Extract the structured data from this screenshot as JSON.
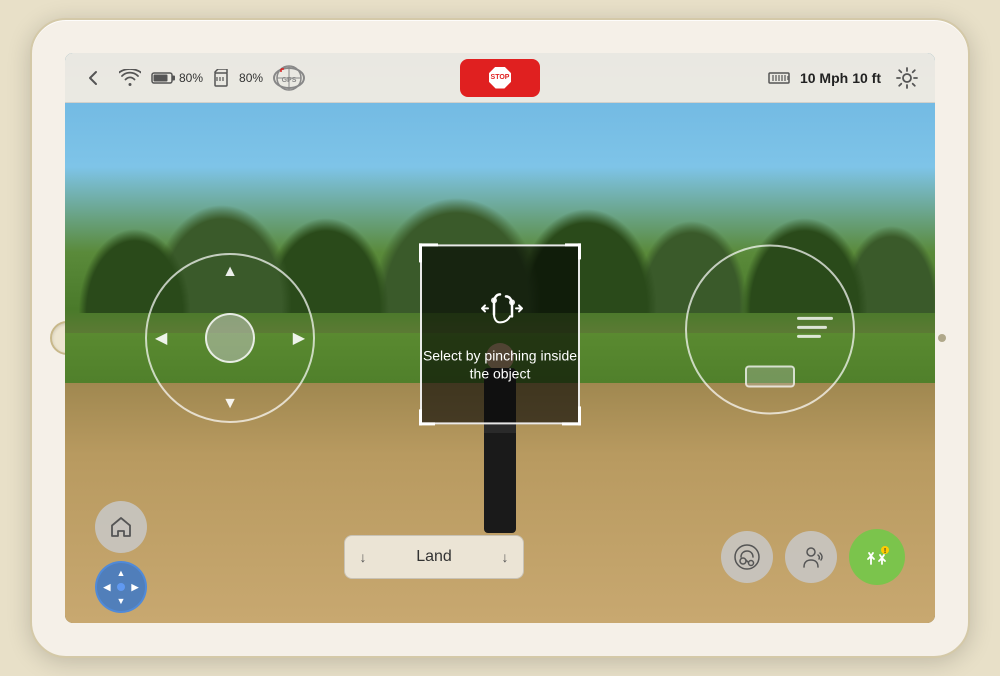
{
  "device": {
    "label": "iPad drone controller"
  },
  "topbar": {
    "back_label": "←",
    "wifi_label": "WiFi",
    "battery1_percent": "80%",
    "battery2_percent": "80%",
    "gps_label": "GPS",
    "stop_label": "STOP",
    "speed_label": "10 Mph",
    "distance_label": "10 ft",
    "settings_label": "⚙"
  },
  "selection": {
    "instruction": "Select by pinching inside the object"
  },
  "bottom": {
    "home_icon": "🏠",
    "land_left_arrow": "↓",
    "land_label": "Land",
    "land_right_arrow": "↓"
  },
  "colors": {
    "stop_red": "#e02020",
    "green_btn": "#7bc44c",
    "blue_dpad": "#3a78c8",
    "topbar_bg": "rgba(240,235,225,0.95)"
  }
}
